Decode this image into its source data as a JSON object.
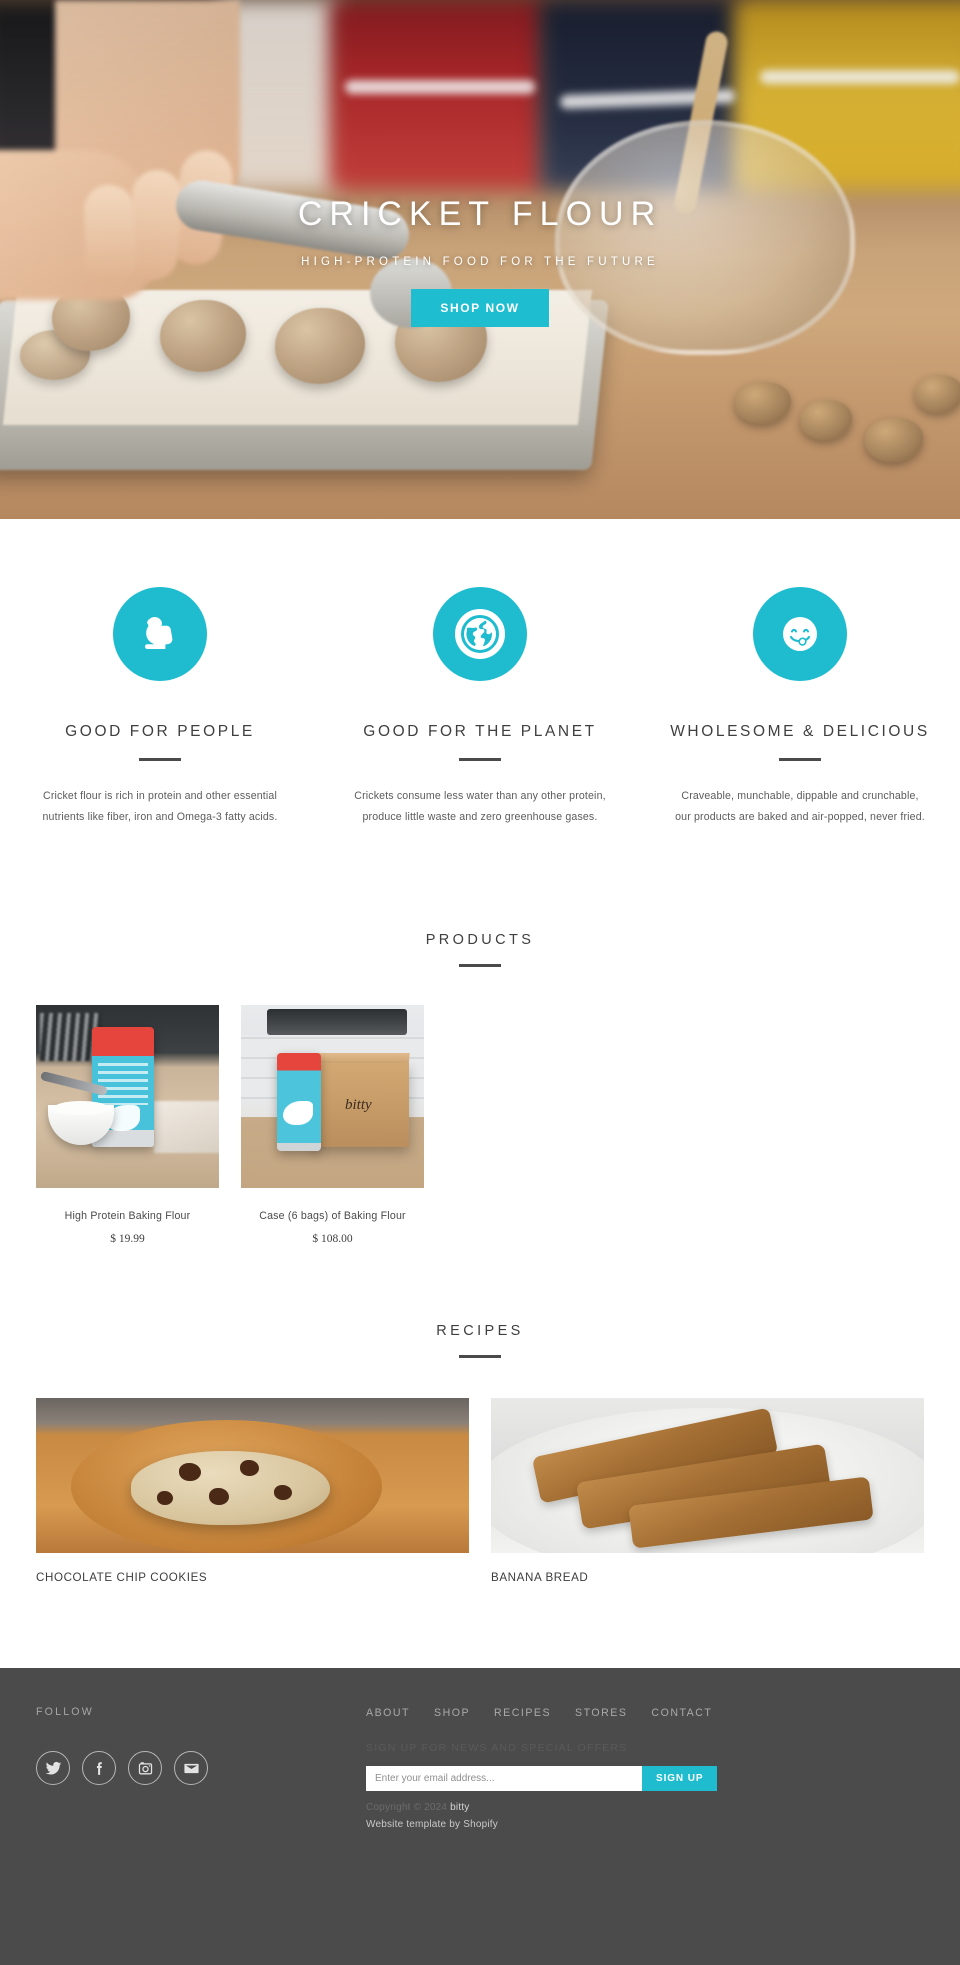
{
  "hero": {
    "title": "CRICKET FLOUR",
    "subtitle": "HIGH-PROTEIN FOOD FOR THE FUTURE",
    "cta_label": "SHOP NOW",
    "accent_color": "#1ebdd0"
  },
  "features": [
    {
      "icon": "muscle-arm-icon",
      "title": "GOOD FOR PEOPLE",
      "text": "Cricket flour is rich in protein and other essential nutrients like fiber, iron and Omega-3 fatty acids."
    },
    {
      "icon": "globe-icon",
      "title": "GOOD FOR THE PLANET",
      "text": "Crickets consume less water than any other protein, produce little waste and zero greenhouse gases."
    },
    {
      "icon": "tongue-smiley-icon",
      "title": "WHOLESOME & DELICIOUS",
      "text": "Craveable, munchable, dippable and crunchable, our products are baked and air-popped, never fried."
    }
  ],
  "products": {
    "heading": "PRODUCTS",
    "items": [
      {
        "name": "High Protein Baking Flour",
        "price": "$ 19.99",
        "image": "bag-of-flour-with-bowl"
      },
      {
        "name": "Case (6 bags) of Baking Flour",
        "price": "$ 108.00",
        "image": "flour-bag-with-bitty-box"
      }
    ]
  },
  "recipes": {
    "heading": "RECIPES",
    "items": [
      {
        "name": "CHOCOLATE CHIP COOKIES",
        "image": "cookie-dough-on-wooden-plate"
      },
      {
        "name": "BANANA BREAD",
        "image": "banana-bread-slices-on-plate"
      }
    ]
  },
  "footer": {
    "follow_label": "FOLLOW",
    "social": [
      {
        "name": "twitter",
        "glyph": "twitter-icon"
      },
      {
        "name": "facebook",
        "glyph": "facebook-icon"
      },
      {
        "name": "instagram",
        "glyph": "instagram-icon"
      },
      {
        "name": "email",
        "glyph": "email-icon"
      }
    ],
    "nav": [
      "ABOUT",
      "SHOP",
      "RECIPES",
      "STORES",
      "CONTACT"
    ],
    "signup_label": "SIGN UP FOR NEWS AND SPECIAL OFFERS",
    "email_placeholder": "Enter your email address...",
    "signup_button": "SIGN UP",
    "copyright": "Copyright © 2024",
    "brand": "bitty",
    "credit": "Website template by Shopify"
  }
}
